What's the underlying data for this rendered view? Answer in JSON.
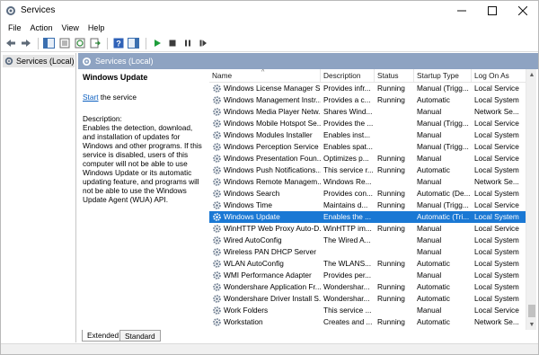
{
  "window": {
    "title": "Services"
  },
  "menu": [
    "File",
    "Action",
    "View",
    "Help"
  ],
  "toolbar_icons": [
    "back-arrow-icon",
    "forward-arrow-icon",
    "console-tree-icon",
    "properties-icon",
    "refresh-icon",
    "export-list-icon",
    "help-icon",
    "show-hide-icon",
    "start-service-icon",
    "stop-service-icon",
    "pause-service-icon",
    "restart-service-icon"
  ],
  "tree": {
    "root_label": "Services (Local)"
  },
  "pane": {
    "header_title": "Services (Local)"
  },
  "detail": {
    "title": "Windows Update",
    "start_link": "Start",
    "start_suffix": " the service",
    "description_label": "Description:",
    "description_text": "Enables the detection, download, and installation of updates for Windows and other programs. If this service is disabled, users of this computer will not be able to use Windows Update or its automatic updating feature, and programs will not be able to use the Windows Update Agent (WUA) API."
  },
  "columns": [
    "Name",
    "Description",
    "Status",
    "Startup Type",
    "Log On As"
  ],
  "services": [
    {
      "name": "Windows License Manager S...",
      "description": "Provides infr...",
      "status": "Running",
      "startup": "Manual (Trigg...",
      "logon": "Local Service"
    },
    {
      "name": "Windows Management Instr...",
      "description": "Provides a c...",
      "status": "Running",
      "startup": "Automatic",
      "logon": "Local System"
    },
    {
      "name": "Windows Media Player Netw...",
      "description": "Shares Wind...",
      "status": "",
      "startup": "Manual",
      "logon": "Network Se..."
    },
    {
      "name": "Windows Mobile Hotspot Se...",
      "description": "Provides the ...",
      "status": "",
      "startup": "Manual (Trigg...",
      "logon": "Local Service"
    },
    {
      "name": "Windows Modules Installer",
      "description": "Enables inst...",
      "status": "",
      "startup": "Manual",
      "logon": "Local System"
    },
    {
      "name": "Windows Perception Service",
      "description": "Enables spat...",
      "status": "",
      "startup": "Manual (Trigg...",
      "logon": "Local Service"
    },
    {
      "name": "Windows Presentation Foun...",
      "description": "Optimizes p...",
      "status": "Running",
      "startup": "Manual",
      "logon": "Local Service"
    },
    {
      "name": "Windows Push Notifications...",
      "description": "This service r...",
      "status": "Running",
      "startup": "Automatic",
      "logon": "Local System"
    },
    {
      "name": "Windows Remote Managem...",
      "description": "Windows Re...",
      "status": "",
      "startup": "Manual",
      "logon": "Network Se..."
    },
    {
      "name": "Windows Search",
      "description": "Provides con...",
      "status": "Running",
      "startup": "Automatic (De...",
      "logon": "Local System"
    },
    {
      "name": "Windows Time",
      "description": "Maintains d...",
      "status": "Running",
      "startup": "Manual (Trigg...",
      "logon": "Local Service"
    },
    {
      "name": "Windows Update",
      "description": "Enables the ...",
      "status": "",
      "startup": "Automatic (Tri...",
      "logon": "Local System"
    },
    {
      "name": "WinHTTP Web Proxy Auto-D...",
      "description": "WinHTTP im...",
      "status": "Running",
      "startup": "Manual",
      "logon": "Local Service"
    },
    {
      "name": "Wired AutoConfig",
      "description": "The Wired A...",
      "status": "",
      "startup": "Manual",
      "logon": "Local System"
    },
    {
      "name": "Wireless PAN DHCP Server",
      "description": "",
      "status": "",
      "startup": "Manual",
      "logon": "Local System"
    },
    {
      "name": "WLAN AutoConfig",
      "description": "The WLANS...",
      "status": "Running",
      "startup": "Automatic",
      "logon": "Local System"
    },
    {
      "name": "WMI Performance Adapter",
      "description": "Provides per...",
      "status": "",
      "startup": "Manual",
      "logon": "Local System"
    },
    {
      "name": "Wondershare Application Fr...",
      "description": "Wondershar...",
      "status": "Running",
      "startup": "Automatic",
      "logon": "Local System"
    },
    {
      "name": "Wondershare Driver Install S...",
      "description": "Wondershar...",
      "status": "Running",
      "startup": "Automatic",
      "logon": "Local System"
    },
    {
      "name": "Work Folders",
      "description": "This service ...",
      "status": "",
      "startup": "Manual",
      "logon": "Local Service"
    },
    {
      "name": "Workstation",
      "description": "Creates and ...",
      "status": "Running",
      "startup": "Automatic",
      "logon": "Network Se..."
    }
  ],
  "selected_service": "Windows Update",
  "tabs": [
    "Extended",
    "Standard"
  ],
  "colors": {
    "selection": "#1a78d4",
    "pane_header": "#8ea3c2",
    "link": "#0b5fc0"
  }
}
